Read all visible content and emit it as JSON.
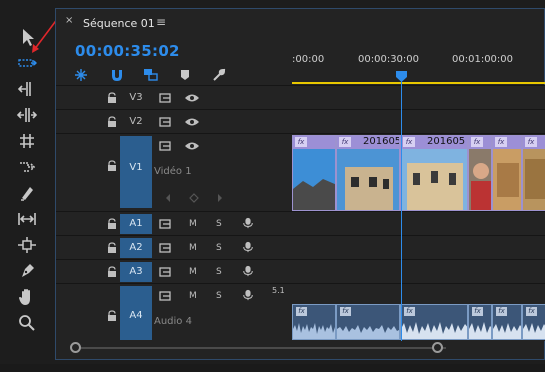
{
  "panel": {
    "close_label": "×",
    "title": "Séquence 01",
    "menu_label": "≡",
    "timecode": "00:00:35:02"
  },
  "ruler": {
    "labels": [
      ":00:00",
      "00:00:30:00",
      "00:01:00:00"
    ]
  },
  "tracks": {
    "video": [
      {
        "id": "V3",
        "label": "V3",
        "name": ""
      },
      {
        "id": "V2",
        "label": "V2",
        "name": ""
      },
      {
        "id": "V1",
        "label": "V1",
        "name": "Vidéo 1"
      }
    ],
    "audio": [
      {
        "id": "A1",
        "label": "A1",
        "m": "M",
        "s": "S"
      },
      {
        "id": "A2",
        "label": "A2",
        "m": "M",
        "s": "S"
      },
      {
        "id": "A3",
        "label": "A3",
        "m": "M",
        "s": "S"
      },
      {
        "id": "A4",
        "label": "A4",
        "m": "M",
        "s": "S",
        "name": "Audio 4",
        "channel": "5.1"
      }
    ]
  },
  "clips": {
    "fx_badge": "fx",
    "video_titles": [
      "201605",
      "201605"
    ]
  },
  "tools": [
    "selection-tool",
    "track-select-tool",
    "ripple-edit-tool",
    "rolling-edit-tool",
    "rate-stretch-tool",
    "razor-tool",
    "slip-tool",
    "slide-tool",
    "pen-tool",
    "hand-tool",
    "zoom-tool"
  ],
  "colors": {
    "accent": "#2d8ceb",
    "target": "#2b5e8f",
    "video_clip": "#7c6fb3",
    "audio_clip": "#3c5678",
    "work_area": "#e8c700",
    "annotation": "#e0272b"
  }
}
